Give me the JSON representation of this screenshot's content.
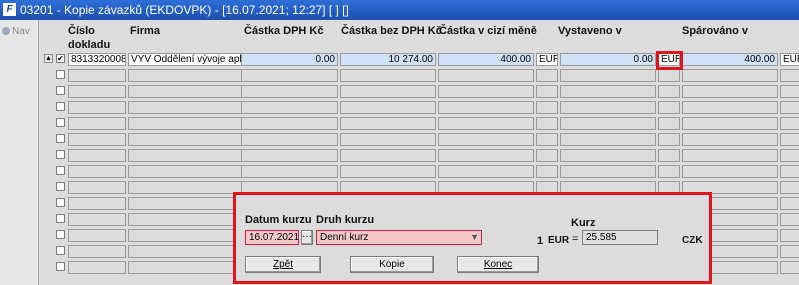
{
  "window": {
    "app_icon": "F",
    "title": "03201 - Kopie závazků (EKDOVPK) - [16.07.2021; 12:27] [ ] []"
  },
  "left_panel": {
    "nav_label": "Nav"
  },
  "columns": {
    "cislo_dokladu": "Číslo\ndokladu",
    "firma": "Firma",
    "castka_dph": "Částka DPH Kč",
    "castka_bez_dph": "Částka bez DPH Kč",
    "castka_mena": "Částka v cizí měně",
    "vystaveno": "Vystaveno v",
    "sparovano": "Spárováno v"
  },
  "rows": [
    {
      "checked": true,
      "cislo": "8313320008",
      "firma": "VYV Oddělení vývoje apli",
      "dph": "0.00",
      "bez_dph": "10 274.00",
      "mena_castka": "400.00",
      "mena": "EUR",
      "vystaveno_castka": "0.00",
      "vystaveno_mena": "EUR",
      "sparovano_castka": "400.00",
      "sparovano_mena": "EUR"
    }
  ],
  "dialog": {
    "datum_label": "Datum kurzu",
    "datum_value": "16.07.2021",
    "druh_label": "Druh kurzu",
    "druh_value": "Denní kurz",
    "kurz_label": "Kurz",
    "qty": "1",
    "from_cur": "EUR",
    "eq": "=",
    "kurz_value": "25.585",
    "to_cur": "CZK",
    "btn_zpet": "Zpět",
    "btn_kopie": "Kopie",
    "btn_konec": "Konec"
  }
}
